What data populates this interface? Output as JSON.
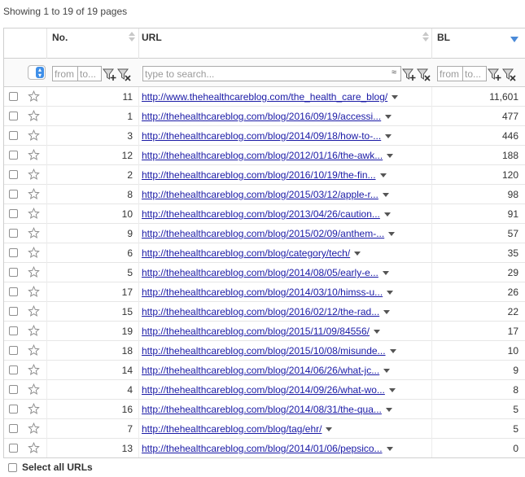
{
  "summary": "Showing 1 to 19 of 19 pages",
  "columns": {
    "no": "No.",
    "url": "URL",
    "bl": "BL"
  },
  "filters": {
    "no_from_placeholder": "from",
    "no_to_placeholder": "to...",
    "url_placeholder": "type to search...",
    "url_approx": "≈",
    "bl_from_placeholder": "from",
    "bl_to_placeholder": "to..."
  },
  "rows": [
    {
      "no": "11",
      "url": "http://www.thehealthcareblog.com/the_health_care_blog/",
      "bl": "11,601"
    },
    {
      "no": "1",
      "url": "http://thehealthcareblog.com/blog/2016/09/19/accessi...",
      "bl": "477"
    },
    {
      "no": "3",
      "url": "http://thehealthcareblog.com/blog/2014/09/18/how-to-...",
      "bl": "446"
    },
    {
      "no": "12",
      "url": "http://thehealthcareblog.com/blog/2012/01/16/the-awk...",
      "bl": "188"
    },
    {
      "no": "2",
      "url": "http://thehealthcareblog.com/blog/2016/10/19/the-fin...",
      "bl": "120"
    },
    {
      "no": "8",
      "url": "http://thehealthcareblog.com/blog/2015/03/12/apple-r...",
      "bl": "98"
    },
    {
      "no": "10",
      "url": "http://thehealthcareblog.com/blog/2013/04/26/caution...",
      "bl": "91"
    },
    {
      "no": "9",
      "url": "http://thehealthcareblog.com/blog/2015/02/09/anthem-...",
      "bl": "57"
    },
    {
      "no": "6",
      "url": "http://thehealthcareblog.com/blog/category/tech/",
      "bl": "35"
    },
    {
      "no": "5",
      "url": "http://thehealthcareblog.com/blog/2014/08/05/early-e...",
      "bl": "29"
    },
    {
      "no": "17",
      "url": "http://thehealthcareblog.com/blog/2014/03/10/himss-u...",
      "bl": "26"
    },
    {
      "no": "15",
      "url": "http://thehealthcareblog.com/blog/2016/02/12/the-rad...",
      "bl": "22"
    },
    {
      "no": "19",
      "url": "http://thehealthcareblog.com/blog/2015/11/09/84556/",
      "bl": "17"
    },
    {
      "no": "18",
      "url": "http://thehealthcareblog.com/blog/2015/10/08/misunde...",
      "bl": "10"
    },
    {
      "no": "14",
      "url": "http://thehealthcareblog.com/blog/2014/06/26/what-jc...",
      "bl": "9"
    },
    {
      "no": "4",
      "url": "http://thehealthcareblog.com/blog/2014/09/26/what-wo...",
      "bl": "8"
    },
    {
      "no": "16",
      "url": "http://thehealthcareblog.com/blog/2014/08/31/the-qua...",
      "bl": "5"
    },
    {
      "no": "7",
      "url": "http://thehealthcareblog.com/blog/tag/ehr/",
      "bl": "5"
    },
    {
      "no": "13",
      "url": "http://thehealthcareblog.com/blog/2014/01/06/pepsico...",
      "bl": "0"
    }
  ],
  "footer": {
    "select_all": "Select all URLs"
  },
  "colors": {
    "link": "#1a1aa6",
    "accent": "#3f8fe8",
    "border": "#cfcfcf"
  },
  "icons": {
    "row_star": "star-icon",
    "filter_apply": "funnel-plus-icon",
    "filter_clear": "funnel-x-icon",
    "row_menu": "caret-down-icon"
  }
}
